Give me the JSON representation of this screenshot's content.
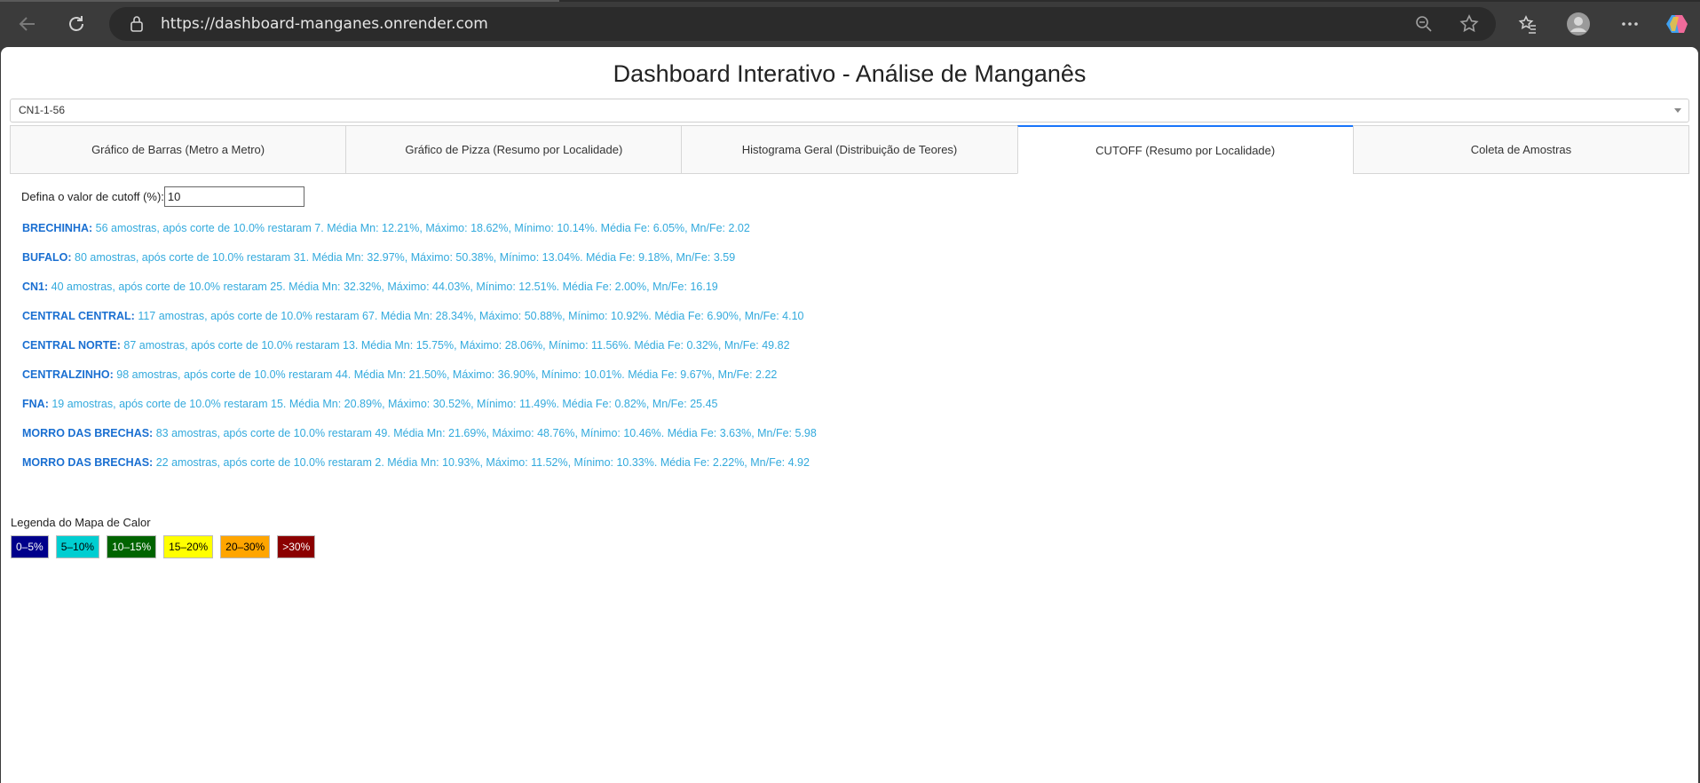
{
  "browser": {
    "url": "https://dashboard-manganes.onrender.com"
  },
  "page": {
    "title": "Dashboard Interativo - Análise de Manganês",
    "dropdown_value": "CN1-1-56",
    "tabs": [
      {
        "label": "Gráfico de Barras (Metro a Metro)",
        "active": false
      },
      {
        "label": "Gráfico de Pizza (Resumo por Localidade)",
        "active": false
      },
      {
        "label": "Histograma Geral (Distribuição de Teores)",
        "active": false
      },
      {
        "label": "CUTOFF (Resumo por Localidade)",
        "active": true
      },
      {
        "label": "Coleta de Amostras",
        "active": false
      }
    ],
    "cutoff": {
      "label": "Defina o valor de cutoff (%):",
      "value": "10"
    },
    "results": [
      {
        "location": "BRECHINHA:",
        "text": "56 amostras, após corte de 10.0% restaram 7. Média Mn: 12.21%, Máximo: 18.62%, Mínimo: 10.14%. Média Fe: 6.05%, Mn/Fe: 2.02"
      },
      {
        "location": "BUFALO:",
        "text": "80 amostras, após corte de 10.0% restaram 31. Média Mn: 32.97%, Máximo: 50.38%, Mínimo: 13.04%. Média Fe: 9.18%, Mn/Fe: 3.59"
      },
      {
        "location": "CN1:",
        "text": "40 amostras, após corte de 10.0% restaram 25. Média Mn: 32.32%, Máximo: 44.03%, Mínimo: 12.51%. Média Fe: 2.00%, Mn/Fe: 16.19"
      },
      {
        "location": "CENTRAL CENTRAL:",
        "text": "117 amostras, após corte de 10.0% restaram 67. Média Mn: 28.34%, Máximo: 50.88%, Mínimo: 10.92%. Média Fe: 6.90%, Mn/Fe: 4.10"
      },
      {
        "location": "CENTRAL NORTE:",
        "text": "87 amostras, após corte de 10.0% restaram 13. Média Mn: 15.75%, Máximo: 28.06%, Mínimo: 11.56%. Média Fe: 0.32%, Mn/Fe: 49.82"
      },
      {
        "location": "CENTRALZINHO:",
        "text": "98 amostras, após corte de 10.0% restaram 44. Média Mn: 21.50%, Máximo: 36.90%, Mínimo: 10.01%. Média Fe: 9.67%, Mn/Fe: 2.22"
      },
      {
        "location": "FNA:",
        "text": "19 amostras, após corte de 10.0% restaram 15. Média Mn: 20.89%, Máximo: 30.52%, Mínimo: 11.49%. Média Fe: 0.82%, Mn/Fe: 25.45"
      },
      {
        "location": "MORRO DAS BRECHAS:",
        "text": "83 amostras, após corte de 10.0% restaram 49. Média Mn: 21.69%, Máximo: 48.76%, Mínimo: 10.46%. Média Fe: 3.63%, Mn/Fe: 5.98"
      },
      {
        "location": "MORRO DAS BRECHAS:",
        "text": "22 amostras, após corte de 10.0% restaram 2. Média Mn: 10.93%, Máximo: 11.52%, Mínimo: 10.33%. Média Fe: 2.22%, Mn/Fe: 4.92"
      }
    ],
    "legend": {
      "title": "Legenda do Mapa de Calor",
      "items": [
        {
          "label": "0–5%",
          "bg": "#00008b",
          "fg": "#ffffff"
        },
        {
          "label": "5–10%",
          "bg": "#00ced1",
          "fg": "#000000"
        },
        {
          "label": "10–15%",
          "bg": "#006400",
          "fg": "#ffffff"
        },
        {
          "label": "15–20%",
          "bg": "#ffff00",
          "fg": "#000000"
        },
        {
          "label": "20–30%",
          "bg": "#ffa500",
          "fg": "#000000"
        },
        {
          "label": ">30%",
          "bg": "#8b0000",
          "fg": "#ffffff"
        }
      ]
    }
  }
}
